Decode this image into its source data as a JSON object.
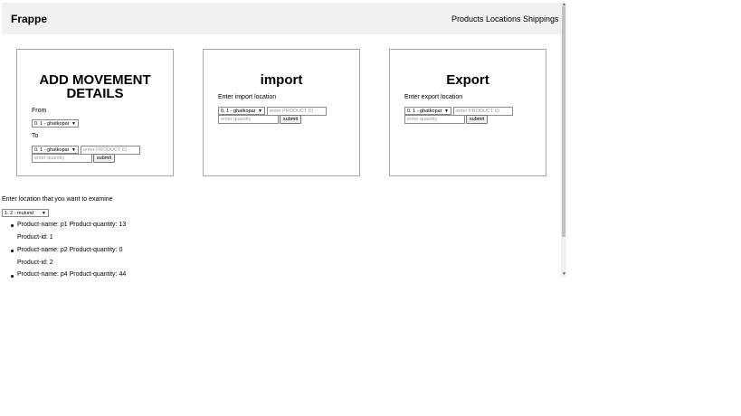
{
  "navbar": {
    "brand": "Frappe",
    "links": [
      "Products",
      "Locations",
      "Shippings"
    ]
  },
  "movement": {
    "title_line1": "ADD MOVEMENT",
    "title_line2": "DETAILS",
    "from_label": "From",
    "from_value": "0. 1 - ghatkopar",
    "to_label": "To",
    "to_value": "0. 1 - ghatkopar",
    "product_placeholder": "enter PRODUCT ID",
    "quantity_placeholder": "enter quantity",
    "submit_label": "submit"
  },
  "import": {
    "title": "import",
    "label": "Enter import location",
    "location_value": "0. 1 - ghatkopar",
    "product_placeholder": "enter PRODUCT ID",
    "quantity_placeholder": "enter quantity",
    "submit_label": "submit"
  },
  "export": {
    "title": "Export",
    "label": "Enter export location",
    "location_value": "0. 1 - ghatkopar",
    "product_placeholder": "enter PRODUCT ID",
    "quantity_placeholder": "enter quantity",
    "submit_label": "submit"
  },
  "examine": {
    "label": "Enter location that you want to examine",
    "location_value": "1. 2 - mulund",
    "items": [
      {
        "name_qty": "Product-name: p1 Product-quantity: 13",
        "id": "Product-id: 1"
      },
      {
        "name_qty": "Product-name: p2 Product-quantity: 0",
        "id": "Product-id: 2"
      },
      {
        "name_qty": "Product-name: p4 Product-quantity: 44",
        "id": ""
      }
    ]
  }
}
